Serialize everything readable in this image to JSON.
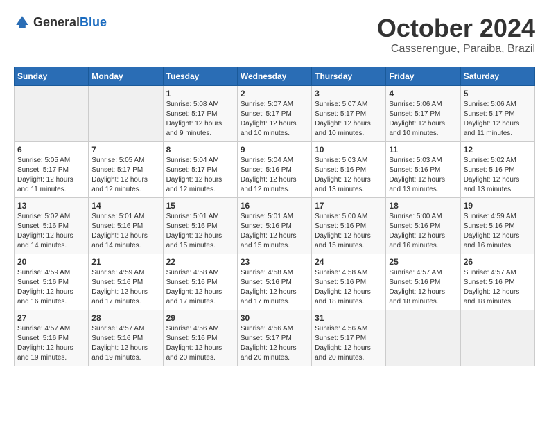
{
  "header": {
    "logo_general": "General",
    "logo_blue": "Blue",
    "month": "October 2024",
    "location": "Casserengue, Paraiba, Brazil"
  },
  "days_of_week": [
    "Sunday",
    "Monday",
    "Tuesday",
    "Wednesday",
    "Thursday",
    "Friday",
    "Saturday"
  ],
  "weeks": [
    [
      {
        "day": "",
        "sunrise": "",
        "sunset": "",
        "daylight": ""
      },
      {
        "day": "",
        "sunrise": "",
        "sunset": "",
        "daylight": ""
      },
      {
        "day": "1",
        "sunrise": "Sunrise: 5:08 AM",
        "sunset": "Sunset: 5:17 PM",
        "daylight": "Daylight: 12 hours and 9 minutes."
      },
      {
        "day": "2",
        "sunrise": "Sunrise: 5:07 AM",
        "sunset": "Sunset: 5:17 PM",
        "daylight": "Daylight: 12 hours and 10 minutes."
      },
      {
        "day": "3",
        "sunrise": "Sunrise: 5:07 AM",
        "sunset": "Sunset: 5:17 PM",
        "daylight": "Daylight: 12 hours and 10 minutes."
      },
      {
        "day": "4",
        "sunrise": "Sunrise: 5:06 AM",
        "sunset": "Sunset: 5:17 PM",
        "daylight": "Daylight: 12 hours and 10 minutes."
      },
      {
        "day": "5",
        "sunrise": "Sunrise: 5:06 AM",
        "sunset": "Sunset: 5:17 PM",
        "daylight": "Daylight: 12 hours and 11 minutes."
      }
    ],
    [
      {
        "day": "6",
        "sunrise": "Sunrise: 5:05 AM",
        "sunset": "Sunset: 5:17 PM",
        "daylight": "Daylight: 12 hours and 11 minutes."
      },
      {
        "day": "7",
        "sunrise": "Sunrise: 5:05 AM",
        "sunset": "Sunset: 5:17 PM",
        "daylight": "Daylight: 12 hours and 12 minutes."
      },
      {
        "day": "8",
        "sunrise": "Sunrise: 5:04 AM",
        "sunset": "Sunset: 5:17 PM",
        "daylight": "Daylight: 12 hours and 12 minutes."
      },
      {
        "day": "9",
        "sunrise": "Sunrise: 5:04 AM",
        "sunset": "Sunset: 5:16 PM",
        "daylight": "Daylight: 12 hours and 12 minutes."
      },
      {
        "day": "10",
        "sunrise": "Sunrise: 5:03 AM",
        "sunset": "Sunset: 5:16 PM",
        "daylight": "Daylight: 12 hours and 13 minutes."
      },
      {
        "day": "11",
        "sunrise": "Sunrise: 5:03 AM",
        "sunset": "Sunset: 5:16 PM",
        "daylight": "Daylight: 12 hours and 13 minutes."
      },
      {
        "day": "12",
        "sunrise": "Sunrise: 5:02 AM",
        "sunset": "Sunset: 5:16 PM",
        "daylight": "Daylight: 12 hours and 13 minutes."
      }
    ],
    [
      {
        "day": "13",
        "sunrise": "Sunrise: 5:02 AM",
        "sunset": "Sunset: 5:16 PM",
        "daylight": "Daylight: 12 hours and 14 minutes."
      },
      {
        "day": "14",
        "sunrise": "Sunrise: 5:01 AM",
        "sunset": "Sunset: 5:16 PM",
        "daylight": "Daylight: 12 hours and 14 minutes."
      },
      {
        "day": "15",
        "sunrise": "Sunrise: 5:01 AM",
        "sunset": "Sunset: 5:16 PM",
        "daylight": "Daylight: 12 hours and 15 minutes."
      },
      {
        "day": "16",
        "sunrise": "Sunrise: 5:01 AM",
        "sunset": "Sunset: 5:16 PM",
        "daylight": "Daylight: 12 hours and 15 minutes."
      },
      {
        "day": "17",
        "sunrise": "Sunrise: 5:00 AM",
        "sunset": "Sunset: 5:16 PM",
        "daylight": "Daylight: 12 hours and 15 minutes."
      },
      {
        "day": "18",
        "sunrise": "Sunrise: 5:00 AM",
        "sunset": "Sunset: 5:16 PM",
        "daylight": "Daylight: 12 hours and 16 minutes."
      },
      {
        "day": "19",
        "sunrise": "Sunrise: 4:59 AM",
        "sunset": "Sunset: 5:16 PM",
        "daylight": "Daylight: 12 hours and 16 minutes."
      }
    ],
    [
      {
        "day": "20",
        "sunrise": "Sunrise: 4:59 AM",
        "sunset": "Sunset: 5:16 PM",
        "daylight": "Daylight: 12 hours and 16 minutes."
      },
      {
        "day": "21",
        "sunrise": "Sunrise: 4:59 AM",
        "sunset": "Sunset: 5:16 PM",
        "daylight": "Daylight: 12 hours and 17 minutes."
      },
      {
        "day": "22",
        "sunrise": "Sunrise: 4:58 AM",
        "sunset": "Sunset: 5:16 PM",
        "daylight": "Daylight: 12 hours and 17 minutes."
      },
      {
        "day": "23",
        "sunrise": "Sunrise: 4:58 AM",
        "sunset": "Sunset: 5:16 PM",
        "daylight": "Daylight: 12 hours and 17 minutes."
      },
      {
        "day": "24",
        "sunrise": "Sunrise: 4:58 AM",
        "sunset": "Sunset: 5:16 PM",
        "daylight": "Daylight: 12 hours and 18 minutes."
      },
      {
        "day": "25",
        "sunrise": "Sunrise: 4:57 AM",
        "sunset": "Sunset: 5:16 PM",
        "daylight": "Daylight: 12 hours and 18 minutes."
      },
      {
        "day": "26",
        "sunrise": "Sunrise: 4:57 AM",
        "sunset": "Sunset: 5:16 PM",
        "daylight": "Daylight: 12 hours and 18 minutes."
      }
    ],
    [
      {
        "day": "27",
        "sunrise": "Sunrise: 4:57 AM",
        "sunset": "Sunset: 5:16 PM",
        "daylight": "Daylight: 12 hours and 19 minutes."
      },
      {
        "day": "28",
        "sunrise": "Sunrise: 4:57 AM",
        "sunset": "Sunset: 5:16 PM",
        "daylight": "Daylight: 12 hours and 19 minutes."
      },
      {
        "day": "29",
        "sunrise": "Sunrise: 4:56 AM",
        "sunset": "Sunset: 5:16 PM",
        "daylight": "Daylight: 12 hours and 20 minutes."
      },
      {
        "day": "30",
        "sunrise": "Sunrise: 4:56 AM",
        "sunset": "Sunset: 5:17 PM",
        "daylight": "Daylight: 12 hours and 20 minutes."
      },
      {
        "day": "31",
        "sunrise": "Sunrise: 4:56 AM",
        "sunset": "Sunset: 5:17 PM",
        "daylight": "Daylight: 12 hours and 20 minutes."
      },
      {
        "day": "",
        "sunrise": "",
        "sunset": "",
        "daylight": ""
      },
      {
        "day": "",
        "sunrise": "",
        "sunset": "",
        "daylight": ""
      }
    ]
  ]
}
